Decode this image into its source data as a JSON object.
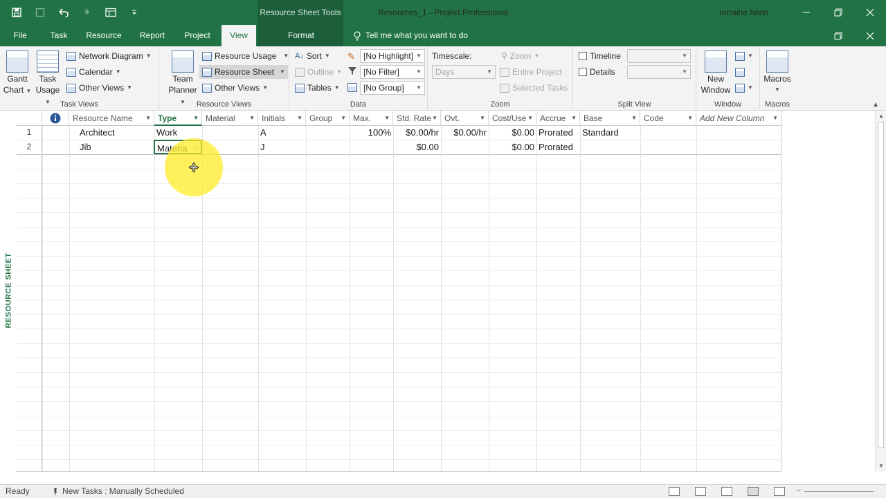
{
  "window": {
    "title": "Resources_1  -  Project Professional",
    "context_tool": "Resource Sheet Tools",
    "user": "lorraine hann"
  },
  "tabs": [
    "File",
    "Task",
    "Resource",
    "Report",
    "Project",
    "View",
    "Format"
  ],
  "tellme": "Tell me what you want to do",
  "ribbon": {
    "task_views": {
      "label": "Task Views",
      "gantt_line1": "Gantt",
      "gantt_line2": "Chart",
      "usage_line1": "Task",
      "usage_line2": "Usage",
      "network": "Network Diagram",
      "calendar": "Calendar",
      "other": "Other Views"
    },
    "resource_views": {
      "label": "Resource Views",
      "team_line1": "Team",
      "team_line2": "Planner",
      "usage": "Resource Usage",
      "sheet": "Resource Sheet",
      "other": "Other Views"
    },
    "data": {
      "label": "Data",
      "sort": "Sort",
      "outline": "Outline",
      "tables": "Tables",
      "highlight": "[No Highlight]",
      "filter": "[No Filter]",
      "group": "[No Group]"
    },
    "zoom": {
      "label": "Zoom",
      "timescale": "Timescale:",
      "timescale_value": "Days",
      "zoom": "Zoom",
      "entire": "Entire Project",
      "selected": "Selected Tasks"
    },
    "split_view": {
      "label": "Split View",
      "timeline": "Timeline",
      "details": "Details"
    },
    "window": {
      "label": "Window",
      "new_line1": "New",
      "new_line2": "Window"
    },
    "macros": {
      "label": "Macros",
      "macros": "Macros"
    }
  },
  "sheet": {
    "side_label": "RESOURCE SHEET",
    "columns": [
      "Resource Name",
      "Type",
      "Material",
      "Initials",
      "Group",
      "Max.",
      "Std. Rate",
      "Ovt.",
      "Cost/Use",
      "Accrue",
      "Base",
      "Code",
      "Add New Column"
    ],
    "rows": [
      {
        "id": "1",
        "name": "Architect",
        "type": "Work",
        "material": "",
        "initials": "A",
        "group": "",
        "max": "100%",
        "std_rate": "$0.00/hr",
        "ovt": "$0.00/hr",
        "cost_use": "$0.00",
        "accrue": "Prorated",
        "base": "Standard",
        "code": ""
      },
      {
        "id": "2",
        "name": "Jib",
        "type": "Materia",
        "material": "",
        "initials": "J",
        "group": "",
        "max": "",
        "std_rate": "$0.00",
        "ovt": "",
        "cost_use": "$0.00",
        "accrue": "Prorated",
        "base": "",
        "code": ""
      }
    ]
  },
  "status": {
    "ready": "Ready",
    "new_tasks": "New Tasks : Manually Scheduled"
  },
  "colors": {
    "brand": "#217346",
    "highlight": "#ffeb28"
  }
}
